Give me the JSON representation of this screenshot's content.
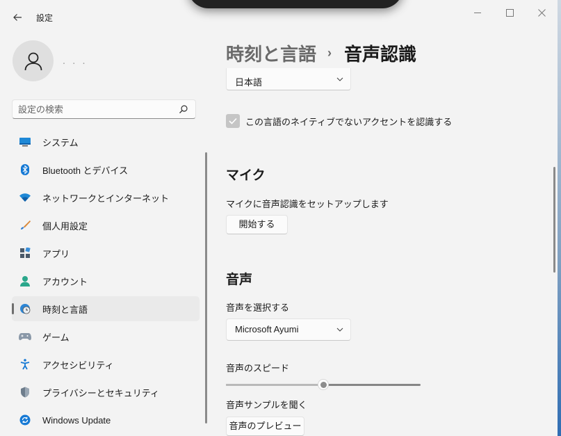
{
  "window": {
    "title": "設定",
    "back_icon": "back-arrow-icon",
    "controls": [
      "minimize-icon",
      "maximize-icon",
      "close-icon"
    ]
  },
  "user": {
    "name": "・ ・ ・",
    "avatar_icon": "person-icon"
  },
  "search": {
    "placeholder": "設定の検索",
    "value": "",
    "icon": "search-icon"
  },
  "sidebar": {
    "items": [
      {
        "label": "システム",
        "icon": "monitor-icon",
        "selected": false
      },
      {
        "label": "Bluetooth とデバイス",
        "icon": "bluetooth-icon",
        "selected": false
      },
      {
        "label": "ネットワークとインターネット",
        "icon": "wifi-icon",
        "selected": false
      },
      {
        "label": "個人用設定",
        "icon": "brush-icon",
        "selected": false
      },
      {
        "label": "アプリ",
        "icon": "apps-icon",
        "selected": false
      },
      {
        "label": "アカウント",
        "icon": "account-icon",
        "selected": false
      },
      {
        "label": "時刻と言語",
        "icon": "globe-clock-icon",
        "selected": true
      },
      {
        "label": "ゲーム",
        "icon": "gamepad-icon",
        "selected": false
      },
      {
        "label": "アクセシビリティ",
        "icon": "accessibility-icon",
        "selected": false
      },
      {
        "label": "プライバシーとセキュリティ",
        "icon": "shield-icon",
        "selected": false
      },
      {
        "label": "Windows Update",
        "icon": "update-icon",
        "selected": false
      }
    ]
  },
  "breadcrumb": {
    "parent": "時刻と言語",
    "separator": "›",
    "current": "音声認識"
  },
  "language": {
    "selected": "日本語"
  },
  "accent_checkbox": {
    "checked": true,
    "label": "この言語のネイティブでないアクセントを認識する"
  },
  "mic": {
    "title": "マイク",
    "setup_label": "マイクに音声認識をセットアップします",
    "start_button": "開始する"
  },
  "voice": {
    "title": "音声",
    "choose_label": "音声を選択する",
    "selected_voice": "Microsoft Ayumi",
    "speed_label": "音声のスピード",
    "speed_fraction": 0.5,
    "sample_label": "音声サンプルを聞く",
    "preview_button": "音声のプレビュー"
  },
  "colors": {
    "background": "#f3f3f3",
    "selected_nav": "#eaeaea",
    "checkbox": "#c5c5c5"
  }
}
